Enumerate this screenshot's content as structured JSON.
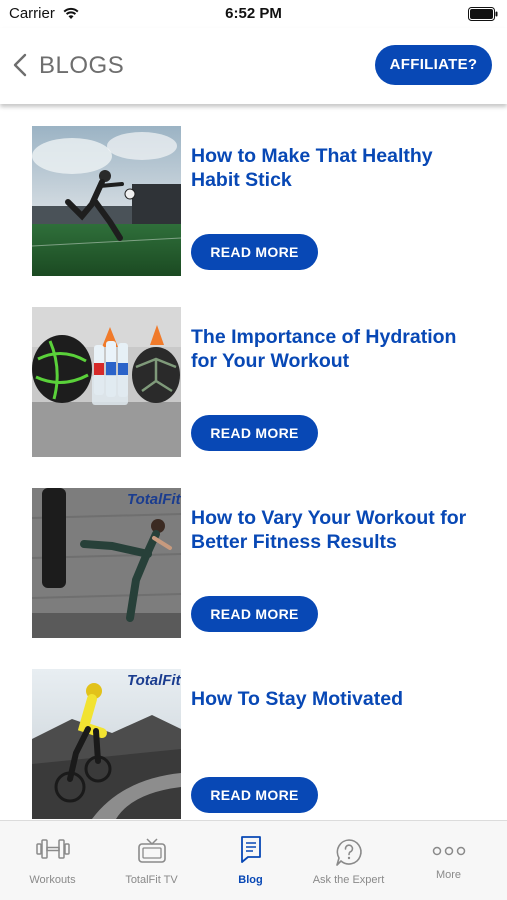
{
  "status_bar": {
    "carrier": "Carrier",
    "time": "6:52 PM"
  },
  "header": {
    "title": "BLOGS",
    "affiliate_label": "AFFILIATE?"
  },
  "blogs": [
    {
      "title": "How to Make That Healthy Habit Stick",
      "button": "READ MORE",
      "image": "soccer-player-photo"
    },
    {
      "title": "The Importance of Hydration for Your Workout",
      "button": "READ MORE",
      "image": "balls-and-water-bottles-photo"
    },
    {
      "title": "How to Vary Your Workout for Better Fitness Results",
      "button": "READ MORE",
      "image": "kickboxing-photo",
      "watermark": "TotalFit"
    },
    {
      "title": "How To Stay Motivated",
      "button": "READ MORE",
      "image": "cyclist-photo",
      "watermark": "TotalFit"
    }
  ],
  "tabs": [
    {
      "label": "Workouts",
      "icon": "dumbbell-icon"
    },
    {
      "label": "TotalFit TV",
      "icon": "tv-icon"
    },
    {
      "label": "Blog",
      "icon": "blog-icon",
      "active": true
    },
    {
      "label": "Ask the Expert",
      "icon": "question-bubble-icon"
    },
    {
      "label": "More",
      "icon": "more-dots-icon"
    }
  ],
  "colors": {
    "brand_blue": "#0848b5",
    "tab_inactive": "#8a8a8a",
    "header_title": "#6e6e6e"
  }
}
